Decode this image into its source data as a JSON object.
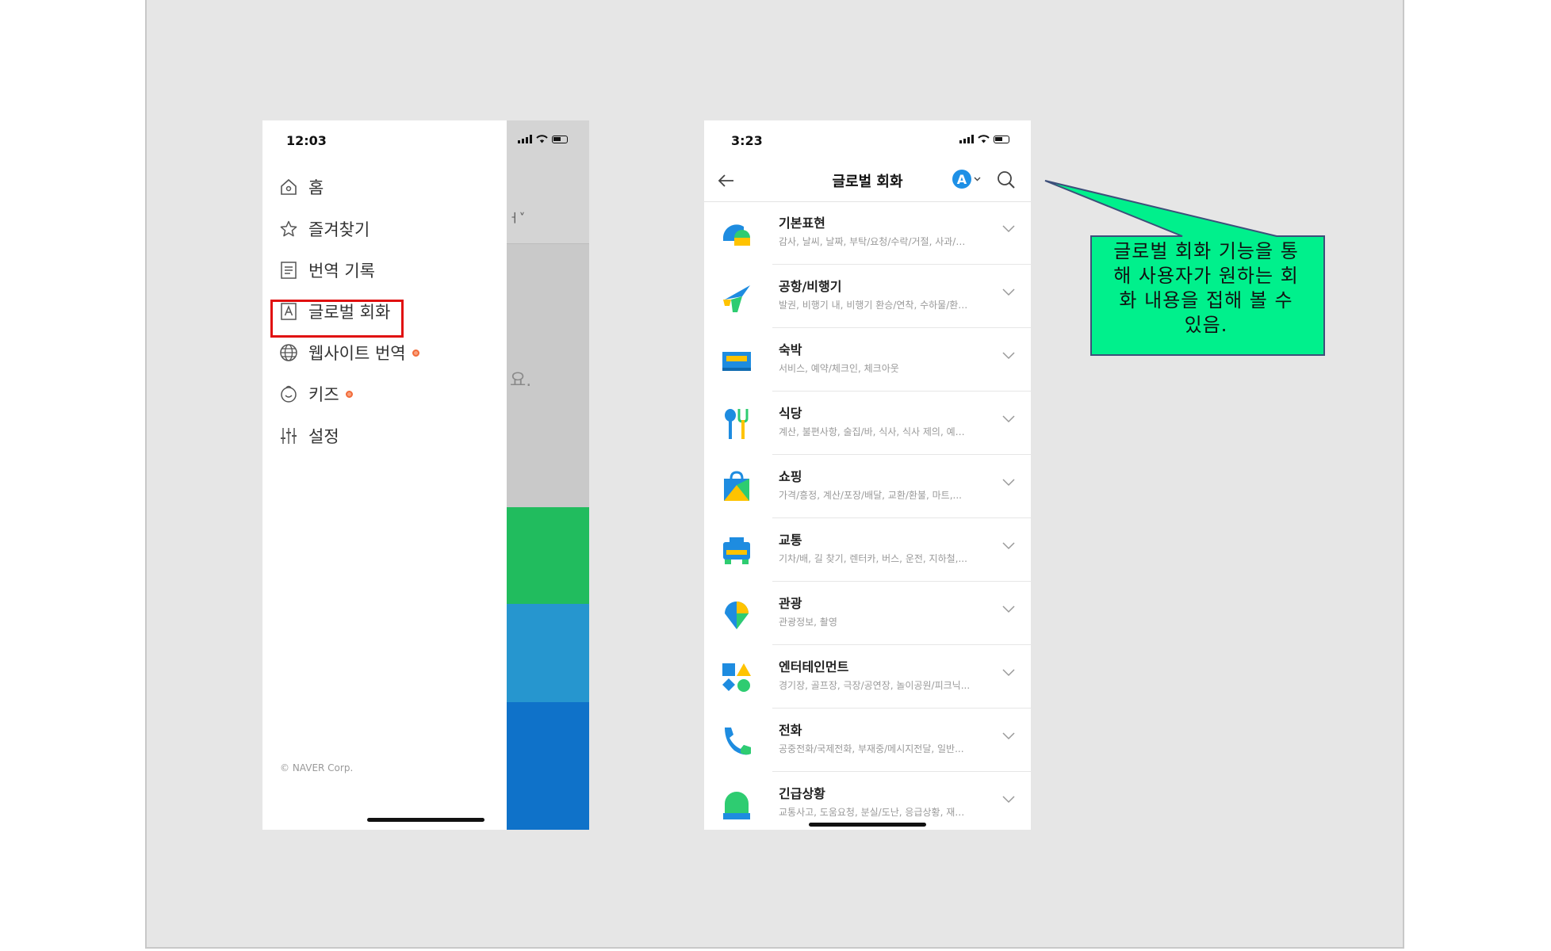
{
  "left_phone": {
    "time": "12:03",
    "menu": [
      {
        "label": "홈",
        "icon": "home-icon"
      },
      {
        "label": "즐겨찾기",
        "icon": "star-icon"
      },
      {
        "label": "번역 기록",
        "icon": "history-document-icon"
      },
      {
        "label": "글로벌 회화",
        "icon": "letter-a-box-icon",
        "highlighted": true
      },
      {
        "label": "웹사이트 번역",
        "icon": "globe-icon",
        "new_dot": true
      },
      {
        "label": "키즈",
        "icon": "kids-smile-icon",
        "new_dot": true
      },
      {
        "label": "설정",
        "icon": "sliders-icon"
      }
    ],
    "copyright": "© NAVER Corp.",
    "behind_partial_top": "ㅓ˅",
    "behind_partial_mid": "요.",
    "colors": {
      "green": "#21bc5e",
      "light_blue": "#2696cf",
      "blue": "#0f72c9",
      "highlight_border": "#e01010"
    }
  },
  "right_phone": {
    "time": "3:23",
    "header": {
      "title": "글로벌 회화",
      "lang_badge": "A"
    },
    "categories": [
      {
        "name": "기본표현",
        "sub": "감사, 날씨, 날짜, 부탁/요청/수락/거절, 사과/…",
        "icon": "basic-expression-icon"
      },
      {
        "name": "공항/비행기",
        "sub": "발권, 비행기 내, 비행기 환승/연착, 수하물/환…",
        "icon": "airplane-icon"
      },
      {
        "name": "숙박",
        "sub": "서비스, 예약/체크인, 체크아웃",
        "icon": "bed-icon"
      },
      {
        "name": "식당",
        "sub": "계산, 불편사항, 술집/바, 식사, 식사 제의, 예…",
        "icon": "fork-spoon-icon"
      },
      {
        "name": "쇼핑",
        "sub": "가격/흥정, 계산/포장/배달, 교환/환불, 마트,...",
        "icon": "shopping-bag-icon"
      },
      {
        "name": "교통",
        "sub": "기차/배, 길 찾기, 렌터카, 버스, 운전, 지하철,...",
        "icon": "bus-icon"
      },
      {
        "name": "관광",
        "sub": "관광정보, 촬영",
        "icon": "map-pin-icon"
      },
      {
        "name": "엔터테인먼트",
        "sub": "경기장, 골프장, 극장/공연장, 놀이공원/피크닉...",
        "icon": "shapes-icon"
      },
      {
        "name": "전화",
        "sub": "공중전화/국제전화, 부재중/메시지전달, 일반...",
        "icon": "phone-icon"
      },
      {
        "name": "긴급상황",
        "sub": "교통사고, 도움요청, 분실/도난, 응급상황, 재…",
        "icon": "alarm-light-icon"
      }
    ]
  },
  "callout": {
    "lines": [
      "글로벌 회화 기능을 통",
      "해 사용자가 원하는 회",
      "화 내용을 접해 볼 수",
      "있음."
    ],
    "fill": "#00f08c",
    "border": "#3d4f7a"
  }
}
